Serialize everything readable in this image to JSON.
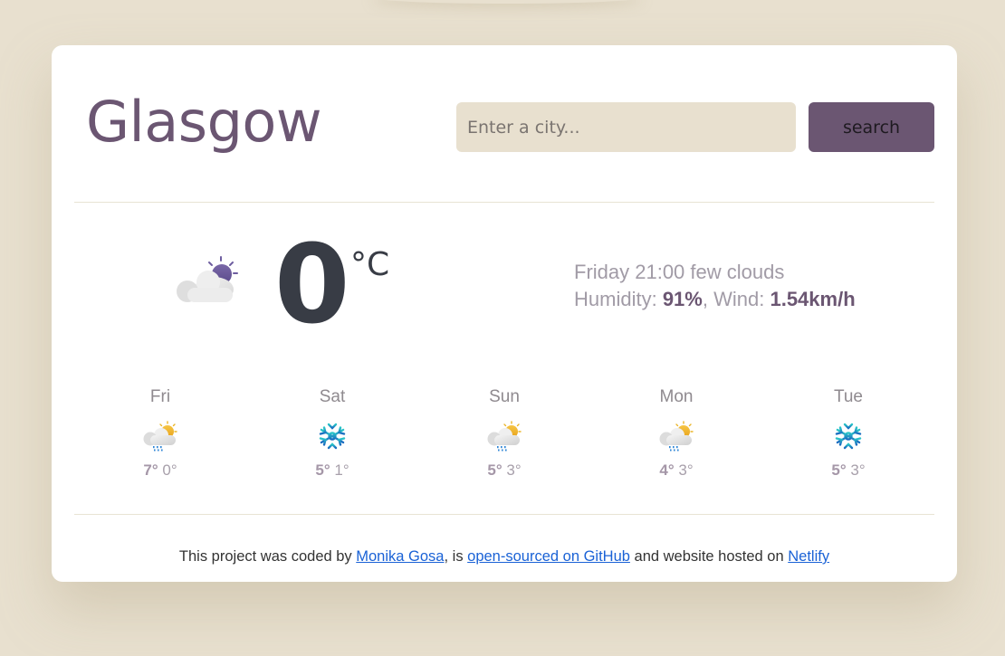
{
  "header": {
    "city": "Glasgow",
    "search_placeholder": "Enter a city...",
    "search_value": "",
    "search_button": "search"
  },
  "current": {
    "icon": "few-clouds-night-icon",
    "temperature": "0",
    "unit": "°C",
    "day_time": "Friday 21:00",
    "description": "few clouds",
    "humidity_label": "Humidity:",
    "humidity_value": "91%",
    "wind_label": "Wind:",
    "wind_value": "1.54km/h"
  },
  "forecast": [
    {
      "day": "Fri",
      "icon": "rain-sun-icon",
      "max": "7°",
      "min": "0°"
    },
    {
      "day": "Sat",
      "icon": "snowflake-icon",
      "max": "5°",
      "min": "1°"
    },
    {
      "day": "Sun",
      "icon": "rain-sun-icon",
      "max": "5°",
      "min": "3°"
    },
    {
      "day": "Mon",
      "icon": "rain-sun-icon",
      "max": "4°",
      "min": "3°"
    },
    {
      "day": "Tue",
      "icon": "snowflake-icon",
      "max": "5°",
      "min": "3°"
    }
  ],
  "footer": {
    "text1": "This project was coded by ",
    "link1": "Monika Gosa",
    "text2": ", is ",
    "link2": "open-sourced on GitHub",
    "text3": " and website hosted on ",
    "link3": "Netlify"
  },
  "colors": {
    "accent": "#6b5672",
    "background": "#e8e0cf",
    "temperature": "#383c45",
    "link": "#1a62d6"
  }
}
